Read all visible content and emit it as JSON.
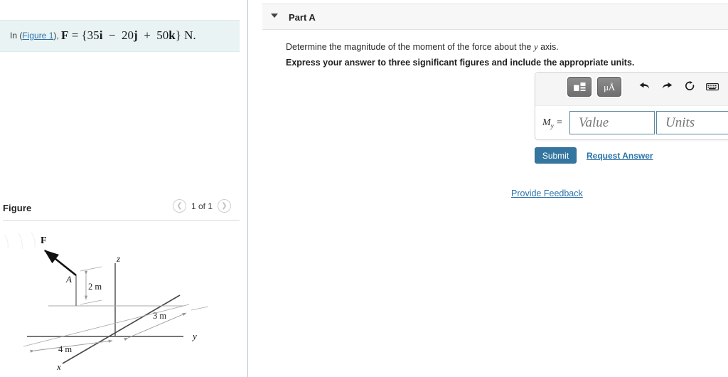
{
  "left": {
    "problem": {
      "prefix": "In (",
      "figure_link": "Figure 1",
      "suffix_after_link": "), ",
      "force_expression": "F = {35i − 20j + 50k} N."
    },
    "figure_section": {
      "title": "Figure",
      "prev_icon": "chevron-left-icon",
      "count_label": "1 of 1",
      "next_icon": "chevron-right-icon"
    },
    "figure_labels": {
      "force": "F",
      "point_a": "A",
      "dim_vertical": "2 m",
      "dim_horizontal": "4 m",
      "dim_diagonal": "3 m",
      "axis_x": "x",
      "axis_y": "y",
      "axis_z": "z"
    }
  },
  "right": {
    "part": {
      "caret_icon": "caret-down-icon",
      "title": "Part A"
    },
    "question": {
      "prompt_before_var": "Determine the magnitude of the moment of the force about the ",
      "prompt_var": "y",
      "prompt_after_var": " axis.",
      "instruction": "Express your answer to three significant figures and include the appropriate units."
    },
    "answer": {
      "toolbar": [
        {
          "name": "math-template-icon",
          "label": "",
          "kind": "dark"
        },
        {
          "name": "units-icon",
          "label": "μÅ",
          "kind": "dark"
        },
        {
          "name": "undo-icon",
          "label": "↶",
          "kind": "plain"
        },
        {
          "name": "redo-icon",
          "label": "↷",
          "kind": "plain"
        },
        {
          "name": "reset-icon",
          "label": "↺",
          "kind": "plain"
        },
        {
          "name": "keyboard-icon",
          "label": "⌨",
          "kind": "plain"
        },
        {
          "name": "help-icon",
          "label": "?",
          "kind": "plain"
        }
      ],
      "label_symbol": "M",
      "label_subscript": "y",
      "label_equals": "=",
      "value_placeholder": "Value",
      "value_text": "",
      "units_placeholder": "Units",
      "units_text": ""
    },
    "actions": {
      "submit_label": "Submit",
      "request_answer_label": "Request Answer",
      "provide_feedback_label": "Provide Feedback"
    }
  },
  "colors": {
    "accent_blue": "#2c73a8",
    "submit_blue": "#3576a0",
    "problem_bg": "#e9f3f4",
    "panel_bg": "#f7f7f7",
    "divider": "#b6c7d8",
    "field_border": "#5b87a3"
  }
}
